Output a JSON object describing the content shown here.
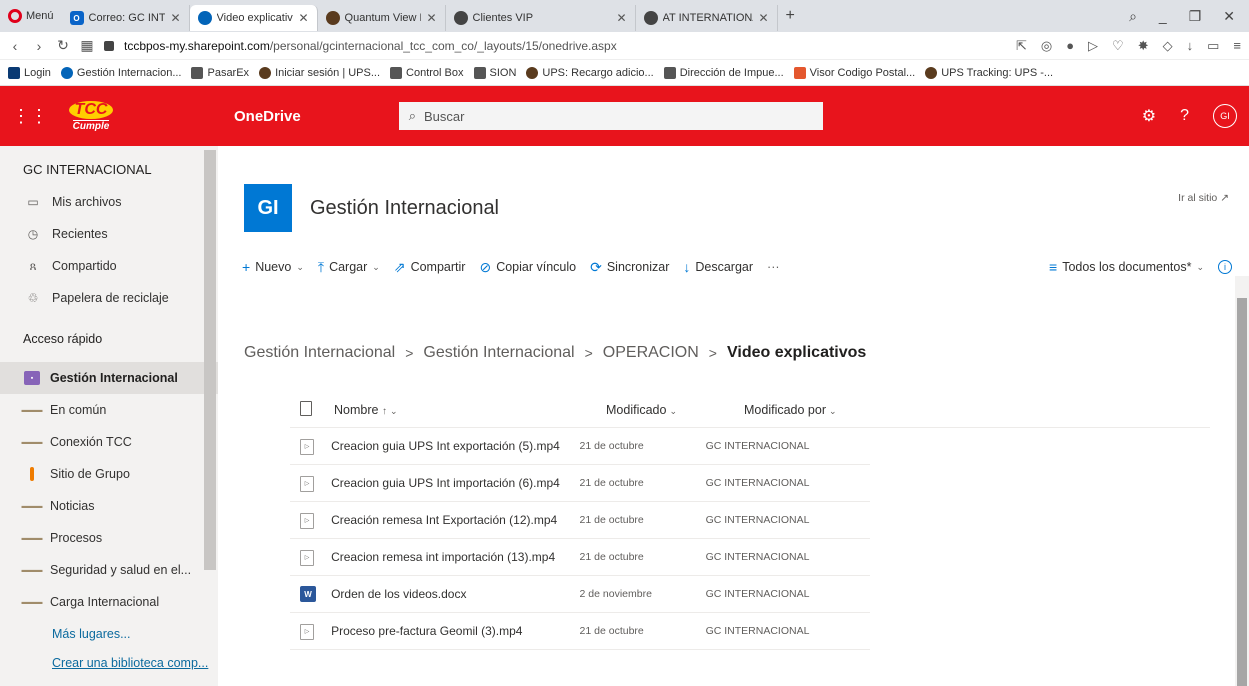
{
  "browser": {
    "menu_label": "Menú",
    "tabs": [
      {
        "title": "Correo: GC INTERNACIONA",
        "icon": "outlook-icon"
      },
      {
        "title": "Video explicativos - OneDr",
        "icon": "onedrive-icon",
        "active": true
      },
      {
        "title": "Quantum View Manage | U",
        "icon": "ups-icon"
      },
      {
        "title": "Clientes VIP",
        "icon": "globe-icon"
      },
      {
        "title": "AT INTERNATIONAL LLC | C",
        "icon": "globe-icon"
      }
    ],
    "url_domain": "tccbpos-my.sharepoint.com",
    "url_path": "/personal/gcinternacional_tcc_com_co/_layouts/15/onedrive.aspx",
    "bookmarks": [
      "Login",
      "Gestión Internacion...",
      "PasarEx",
      "Iniciar sesión | UPS...",
      "Control Box",
      "SION",
      "UPS: Recargo adicio...",
      "Dirección de Impue...",
      "Visor Codigo Postal...",
      "UPS Tracking: UPS -..."
    ]
  },
  "header": {
    "logo_top": "TCC",
    "logo_bottom": "Cumple",
    "app_name": "OneDrive",
    "search_placeholder": "Buscar",
    "avatar_initials": "GI",
    "brand_color": "#e8141c"
  },
  "leftnav": {
    "owner": "GC INTERNACIONAL",
    "items": [
      {
        "label": "Mis archivos",
        "icon": "folder-icon"
      },
      {
        "label": "Recientes",
        "icon": "clock-icon"
      },
      {
        "label": "Compartido",
        "icon": "people-icon"
      },
      {
        "label": "Papelera de reciclaje",
        "icon": "recycle-bin-icon"
      }
    ],
    "quick_access_title": "Acceso rápido",
    "sites": [
      {
        "label": "Gestión Internacional",
        "selected": true
      },
      {
        "label": "En común"
      },
      {
        "label": "Conexión TCC"
      },
      {
        "label": "Sitio de Grupo"
      },
      {
        "label": "Noticias"
      },
      {
        "label": "Procesos"
      },
      {
        "label": "Seguridad y salud en el..."
      },
      {
        "label": "Carga Internacional"
      }
    ],
    "more_places": "Más lugares...",
    "create_library": "Crear una biblioteca comp..."
  },
  "site": {
    "logo_initials": "GI",
    "title": "Gestión Internacional",
    "goto_site": "Ir al sitio"
  },
  "commands": {
    "new": "Nuevo",
    "upload": "Cargar",
    "share": "Compartir",
    "copy_link": "Copiar vínculo",
    "sync": "Sincronizar",
    "download": "Descargar",
    "view": "Todos los documentos*"
  },
  "breadcrumb": [
    "Gestión Internacional",
    "Gestión Internacional",
    "OPERACION",
    "Video explicativos"
  ],
  "files": {
    "columns": {
      "name": "Nombre",
      "modified": "Modificado",
      "modified_by": "Modificado por"
    },
    "rows": [
      {
        "name": "Creacion guia UPS Int exportación (5).mp4",
        "modified": "21 de octubre",
        "by": "GC INTERNACIONAL",
        "type": "video"
      },
      {
        "name": "Creacion guia UPS Int importación (6).mp4",
        "modified": "21 de octubre",
        "by": "GC INTERNACIONAL",
        "type": "video"
      },
      {
        "name": "Creación remesa Int Exportación (12).mp4",
        "modified": "21 de octubre",
        "by": "GC INTERNACIONAL",
        "type": "video"
      },
      {
        "name": "Creacion remesa int importación (13).mp4",
        "modified": "21 de octubre",
        "by": "GC INTERNACIONAL",
        "type": "video"
      },
      {
        "name": "Orden de los videos.docx",
        "modified": "2 de noviembre",
        "by": "GC INTERNACIONAL",
        "type": "word"
      },
      {
        "name": "Proceso pre-factura Geomil (3).mp4",
        "modified": "21 de octubre",
        "by": "GC INTERNACIONAL",
        "type": "video"
      }
    ]
  }
}
